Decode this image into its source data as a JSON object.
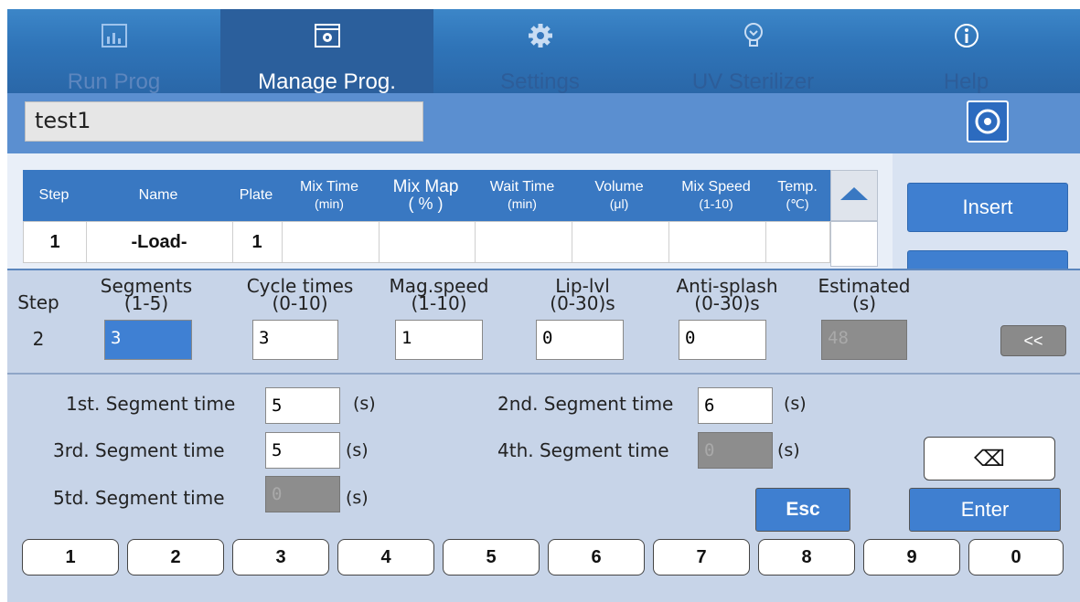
{
  "nav": {
    "tabs": [
      {
        "label": "Run Prog",
        "icon": "chart-icon"
      },
      {
        "label": "Manage Prog.",
        "icon": "manage-icon",
        "active": true
      },
      {
        "label": "Settings",
        "icon": "gear-icon"
      },
      {
        "label": "UV Sterilizer",
        "icon": "bulb-icon"
      },
      {
        "label": "Help",
        "icon": "info-icon"
      }
    ]
  },
  "program": {
    "name": "test1"
  },
  "table": {
    "headers": [
      {
        "title": "Step",
        "sub": ""
      },
      {
        "title": "Name",
        "sub": ""
      },
      {
        "title": "Plate",
        "sub": ""
      },
      {
        "title": "Mix Time",
        "sub": "(min)"
      },
      {
        "title": "Mix Map",
        "sub": "( % )"
      },
      {
        "title": "Wait Time",
        "sub": "(min)"
      },
      {
        "title": "Volume",
        "sub": "(μl)"
      },
      {
        "title": "Mix Speed",
        "sub": "(1-10)"
      },
      {
        "title": "Temp.",
        "sub": "(℃)"
      }
    ],
    "rows": [
      {
        "step": "1",
        "name": "-Load-",
        "plate": "1",
        "mix_time": "",
        "mix_map": "",
        "wait_time": "",
        "volume": "",
        "mix_speed": "",
        "temp": ""
      }
    ]
  },
  "side_buttons": {
    "insert": "Insert"
  },
  "settings": {
    "step_label": "Step",
    "step_value": "2",
    "segments": {
      "title": "Segments",
      "range": "(1-5)",
      "value": "3"
    },
    "cycle_times": {
      "title": "Cycle times",
      "range": "(0-10)",
      "value": "3"
    },
    "mag_speed": {
      "title": "Mag.speed",
      "range": "(1-10)",
      "value": "1"
    },
    "lip_lvl": {
      "title": "Lip-lvl",
      "range": "(0-30)s",
      "value": "0"
    },
    "anti_splash": {
      "title": "Anti-splash",
      "range": "(0-30)s",
      "value": "0"
    },
    "estimated": {
      "title": "Estimated",
      "range": "(s)",
      "value": "48"
    },
    "collapse_label": "<<"
  },
  "segments": {
    "s1": {
      "label": "1st. Segment time",
      "value": "5",
      "unit": "(s)"
    },
    "s2": {
      "label": "2nd. Segment time",
      "value": "6",
      "unit": "(s)"
    },
    "s3": {
      "label": "3rd. Segment time",
      "value": "5",
      "unit": "(s)"
    },
    "s4": {
      "label": "4th. Segment time",
      "value": "0",
      "unit": "(s)"
    },
    "s5": {
      "label": "5td. Segment time",
      "value": "0",
      "unit": "(s)"
    }
  },
  "keypad": {
    "backspace_label": "⌫",
    "esc_label": "Esc",
    "enter_label": "Enter",
    "digits": [
      "1",
      "2",
      "3",
      "4",
      "5",
      "6",
      "7",
      "8",
      "9",
      "0"
    ]
  },
  "colors": {
    "accent": "#3f7fd0",
    "nav": "#2f74b8",
    "panel": "#c7d4e8"
  }
}
